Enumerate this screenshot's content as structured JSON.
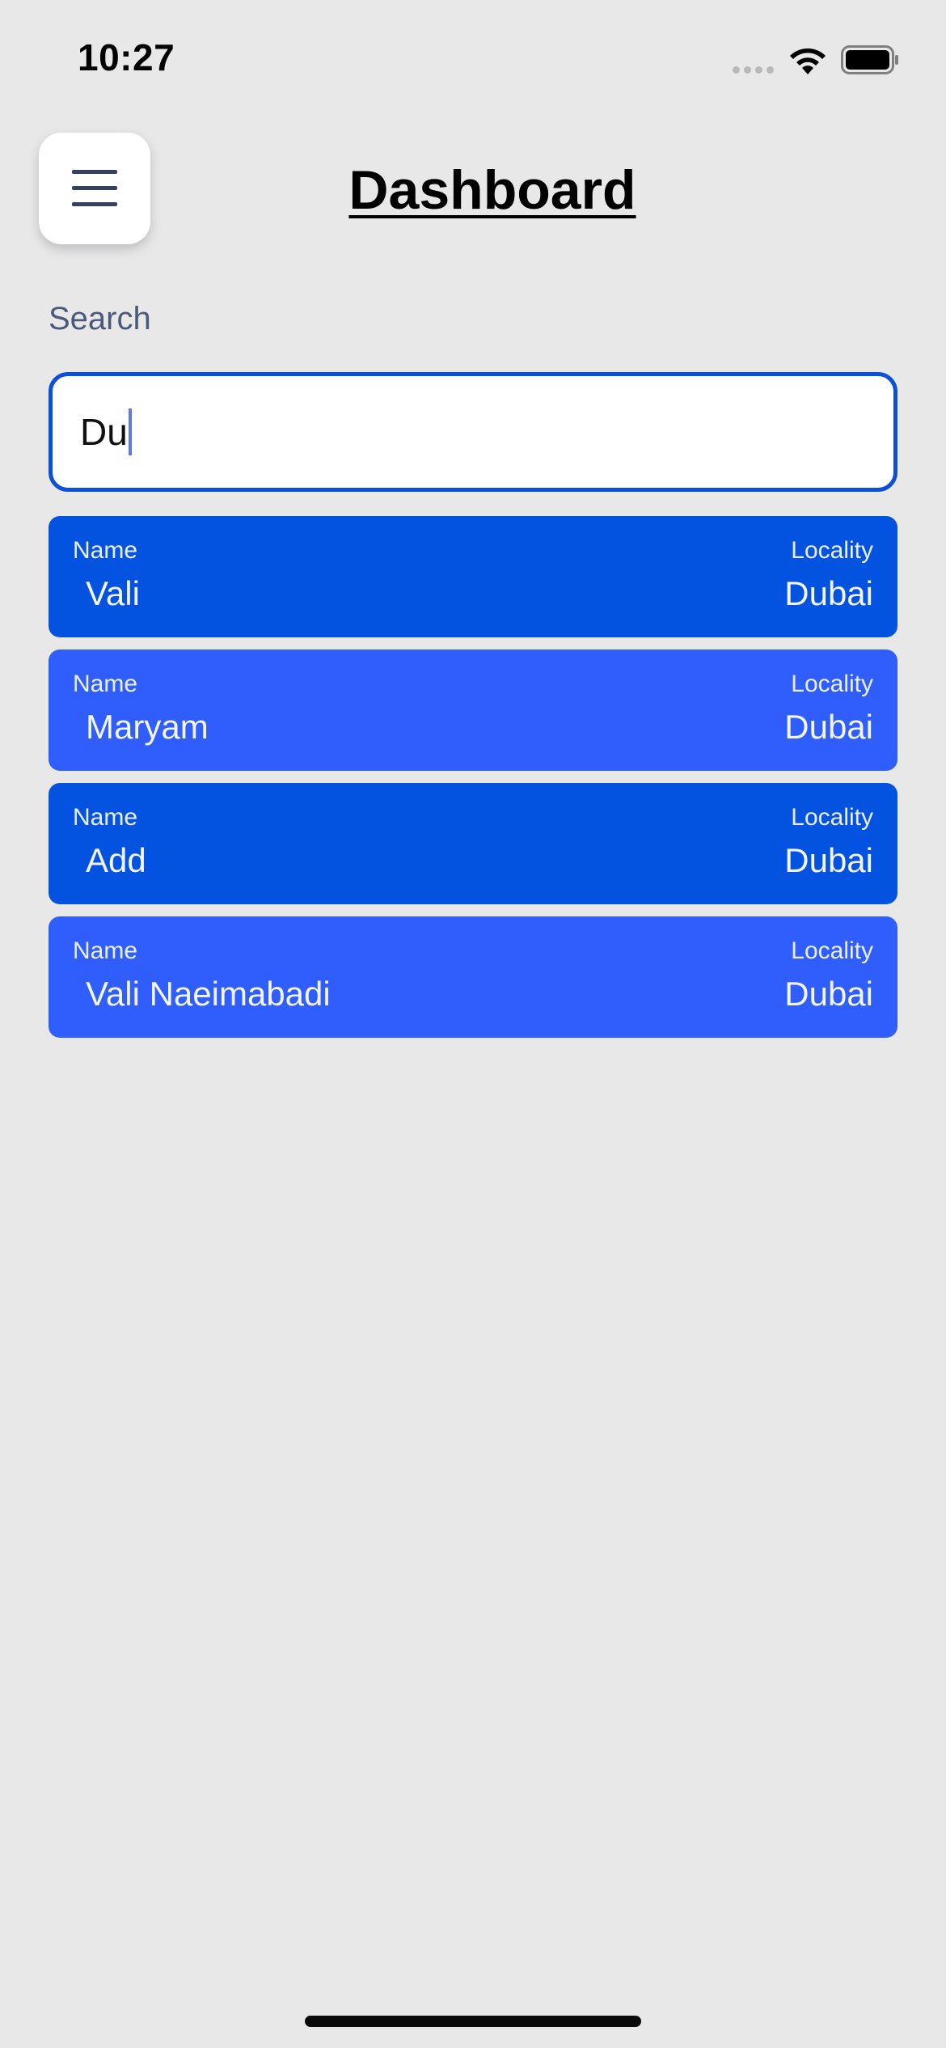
{
  "status_bar": {
    "time": "10:27"
  },
  "header": {
    "title": "Dashboard",
    "menu_icon": "hamburger-icon"
  },
  "search": {
    "label": "Search",
    "value": "Du"
  },
  "results": [
    {
      "name_label": "Name",
      "name": "Vali",
      "locality_label": "Locality",
      "locality": "Dubai"
    },
    {
      "name_label": "Name",
      "name": "Maryam",
      "locality_label": "Locality",
      "locality": "Dubai"
    },
    {
      "name_label": "Name",
      "name": "Add",
      "locality_label": "Locality",
      "locality": "Dubai"
    },
    {
      "name_label": "Name",
      "name": "Vali Naeimabadi",
      "locality_label": "Locality",
      "locality": "Dubai"
    }
  ],
  "colors": {
    "background": "#e8e8e9",
    "card_dark": "#0352e0",
    "card_light": "#305efc",
    "input_border": "#0d4fd6"
  }
}
